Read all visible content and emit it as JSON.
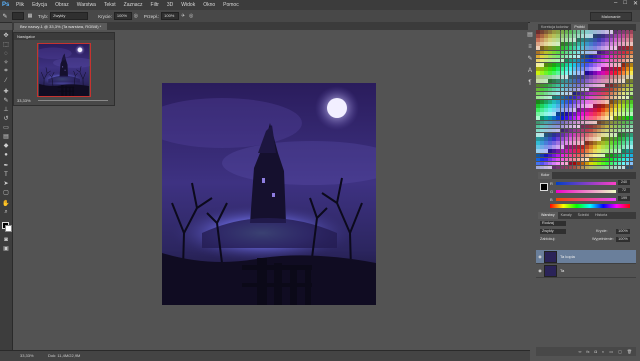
{
  "app": {
    "logo": "Ps"
  },
  "menu": [
    "Plik",
    "Edycja",
    "Obraz",
    "Warstwa",
    "Tekst",
    "Zaznacz",
    "Filtr",
    "3D",
    "Widok",
    "Okno",
    "Pomoc"
  ],
  "window_controls": [
    "–",
    "□",
    "✕"
  ],
  "options": {
    "tryb_label": "Tryb:",
    "tryb_value": "Zwykły",
    "krycie_label": "Krycie:",
    "krycie_value": "100%",
    "przeplyw_label": "Przepł.:",
    "przeplyw_value": "100%",
    "workspace": "Malowanie"
  },
  "document_tab": "Bez nazwy-1 @ 33,3% (Ta warstwa, RGB/8) *",
  "navigator": {
    "title": "Nawigator",
    "zoom": "33,33%"
  },
  "status": {
    "zoom": "33,33%",
    "doc": "Dok: 11,4M/22,9M"
  },
  "panels": {
    "swatch_tabs": [
      "Korekcja kolorów",
      "Próbki"
    ],
    "color_tab": "Kolor",
    "sliders": [
      {
        "label": "R",
        "value": "240",
        "color": "#d04040"
      },
      {
        "label": "G",
        "value": "72",
        "color": "#40b040"
      },
      {
        "label": "B",
        "value": "199",
        "color": "#4060d0"
      }
    ],
    "layer_tabs": [
      "Warstwy",
      "Kanały",
      "Ścieżki",
      "Historia"
    ],
    "layers_blend": "Zwykły",
    "layers_opacity_label": "Krycie:",
    "layers_opacity": "100%",
    "layers_lock_label": "Zablokuj:",
    "layers_fill_label": "Wypełnienie:",
    "layers_fill": "100%",
    "layers_filter": "Rodzaj",
    "layers": [
      {
        "name": "Ta kopia",
        "selected": true
      },
      {
        "name": "Ta",
        "selected": false
      }
    ]
  }
}
